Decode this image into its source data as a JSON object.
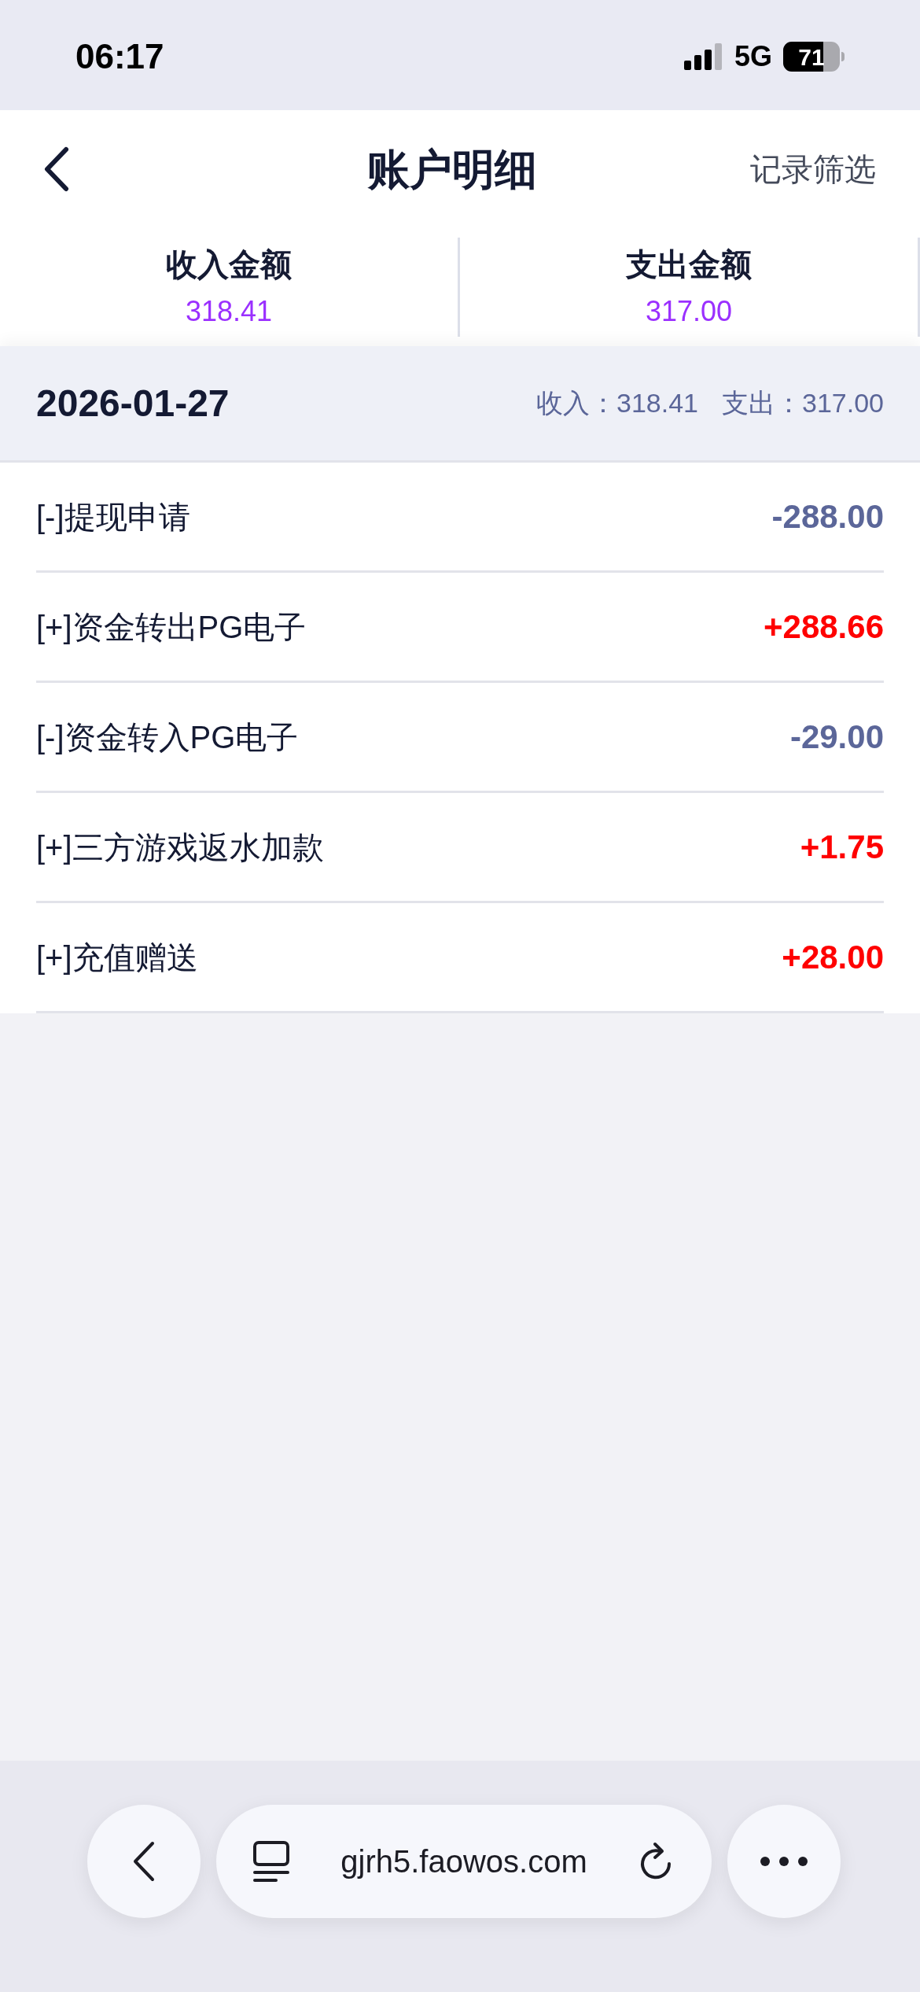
{
  "status_bar": {
    "time": "06:17",
    "network": "5G",
    "battery": "71"
  },
  "header": {
    "title": "账户明细",
    "action": "记录筛选"
  },
  "summary": [
    {
      "label": "收入金额",
      "value": "318.41"
    },
    {
      "label": "支出金额",
      "value": "317.00"
    }
  ],
  "day": {
    "date": "2026-01-27",
    "income_label": "收入：",
    "income": "318.41",
    "expense_label": "支出：",
    "expense": "317.00"
  },
  "records": [
    {
      "title": "[-]提现申请",
      "amount": "-288.00",
      "kind": "expense"
    },
    {
      "title": "[+]资金转出PG电子",
      "amount": "+288.66",
      "kind": "income"
    },
    {
      "title": "[-]资金转入PG电子",
      "amount": "-29.00",
      "kind": "expense"
    },
    {
      "title": "[+]三方游戏返水加款",
      "amount": "+1.75",
      "kind": "income"
    },
    {
      "title": "[+]充值赠送",
      "amount": "+28.00",
      "kind": "income"
    }
  ],
  "browser": {
    "url": "gjrh5.faowos.com"
  }
}
